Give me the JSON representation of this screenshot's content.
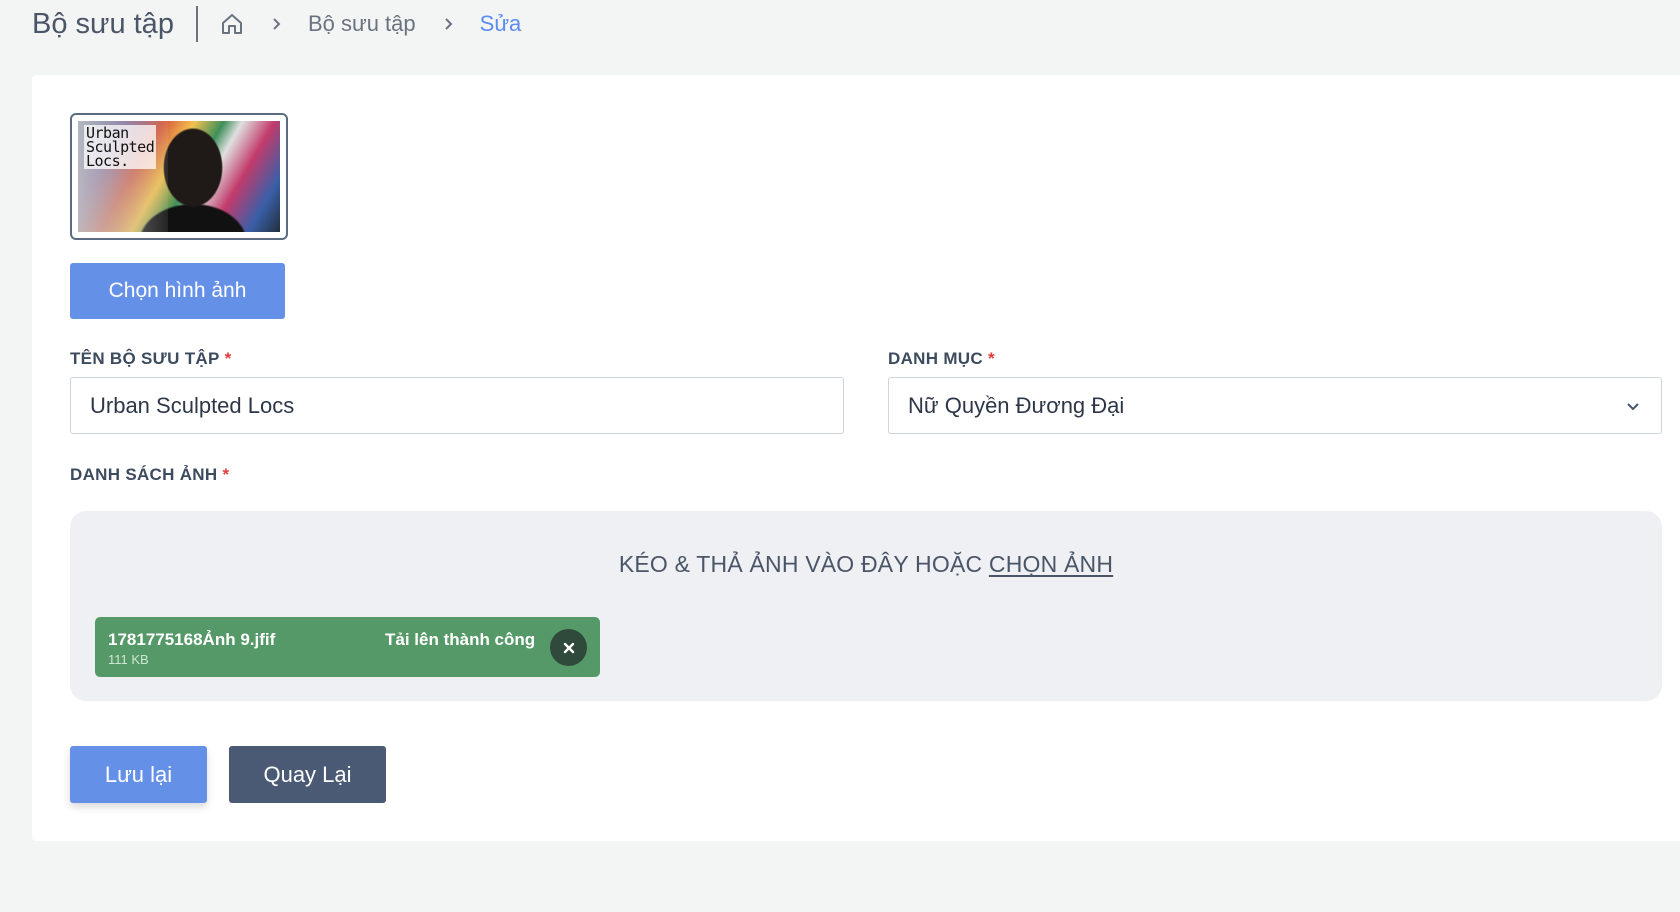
{
  "header": {
    "title": "Bộ sưu tập",
    "breadcrumb": {
      "home_icon": "home-icon",
      "items": [
        "Bộ sưu tập",
        "Sửa"
      ]
    }
  },
  "form": {
    "thumbnail": {
      "overlay_text": [
        "Urban",
        "Sculpted",
        "Locs."
      ]
    },
    "choose_image_button": "Chọn hình ảnh",
    "name_field": {
      "label": "TÊN BỘ SƯU TẬP",
      "required_mark": "*",
      "value": "Urban Sculpted Locs"
    },
    "category_field": {
      "label": "DANH MỤC",
      "required_mark": "*",
      "selected": "Nữ Quyền Đương Đại"
    },
    "image_list": {
      "label": "DANH SÁCH ẢNH",
      "required_mark": "*",
      "dropzone_text": "KÉO & THẢ ẢNH VÀO ĐÂY HOẶC",
      "dropzone_link": "CHỌN ẢNH",
      "files": [
        {
          "name": "1781775168Ảnh 9.jfif",
          "size": "111 KB",
          "status": "Tải lên thành công"
        }
      ]
    },
    "save_button": "Lưu lại",
    "back_button": "Quay Lại"
  },
  "colors": {
    "primary": "#6590e8",
    "secondary": "#4a5a74",
    "success": "#569968",
    "required": "#e03b3b",
    "breadcrumb_active": "#5b8def"
  }
}
